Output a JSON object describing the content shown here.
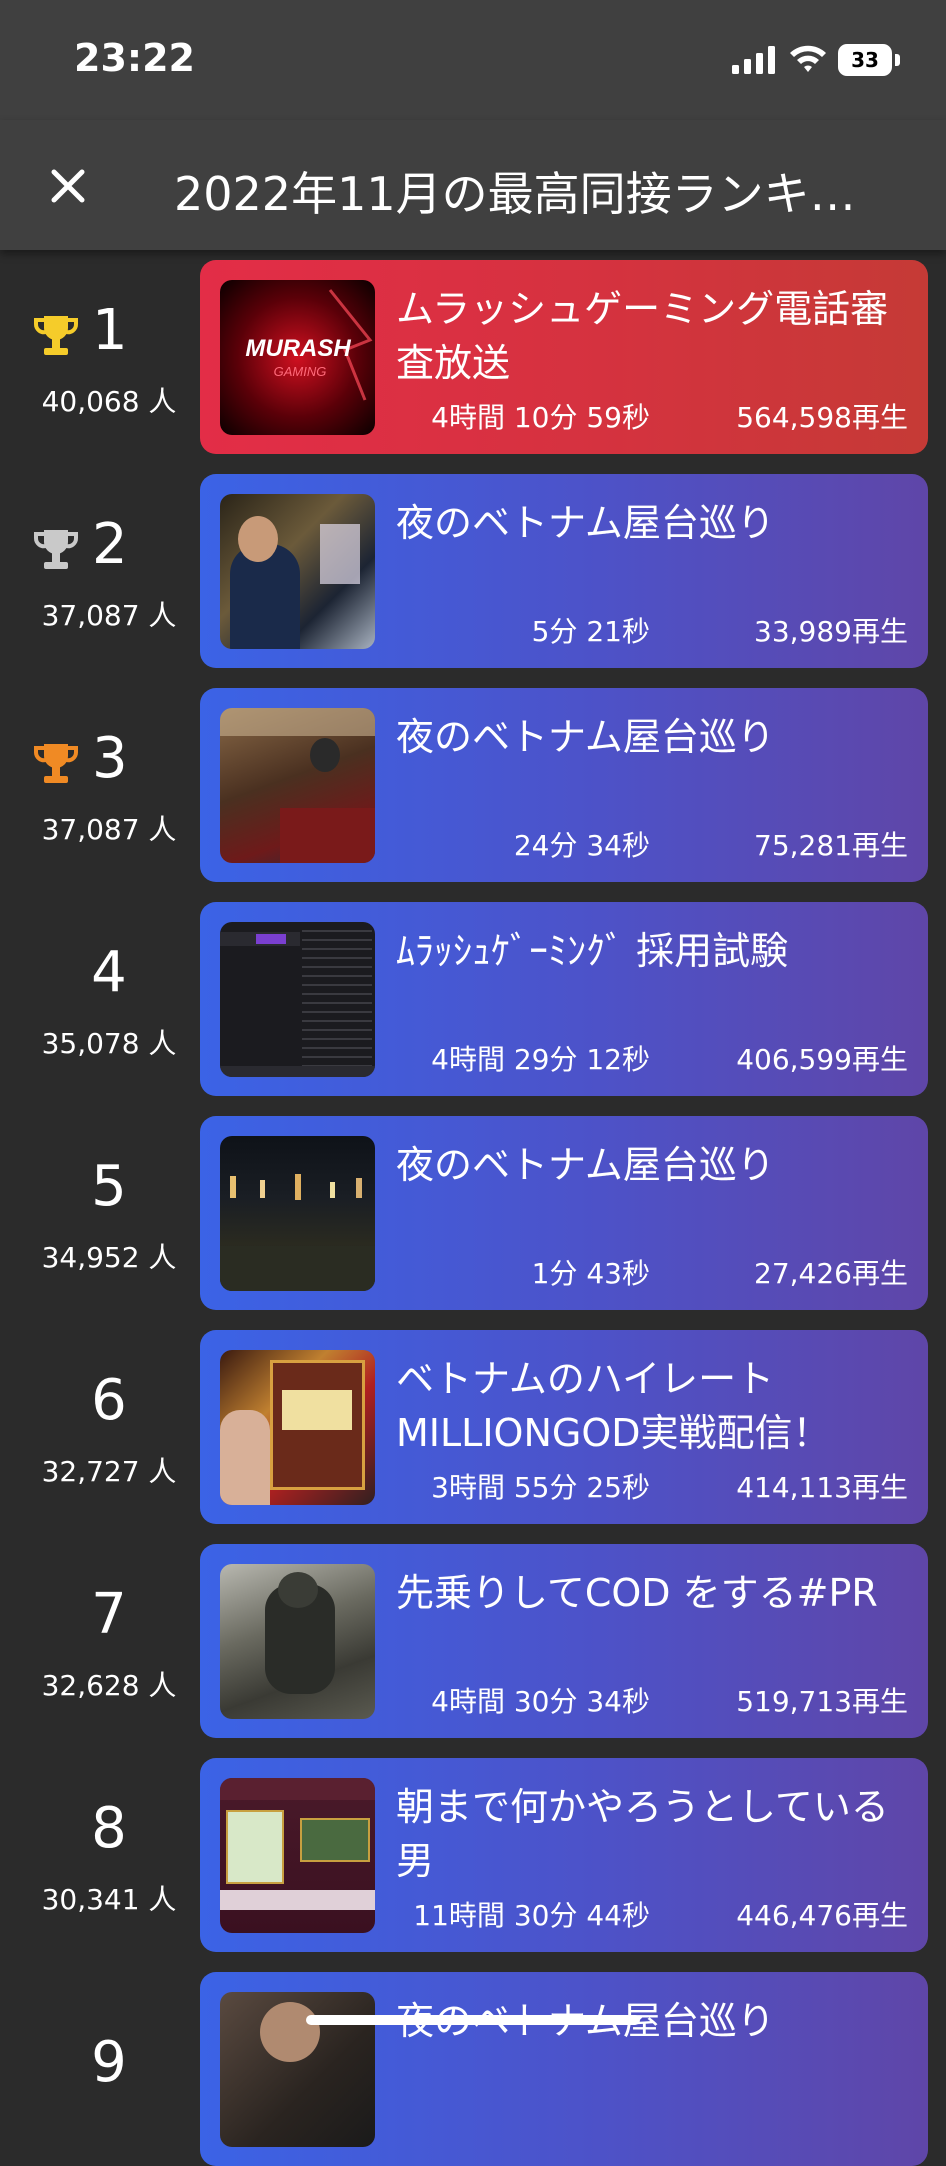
{
  "status_bar": {
    "time": "23:22",
    "battery": "33"
  },
  "header": {
    "title": "2022年11月の最高同接ランキ…"
  },
  "rankings": [
    {
      "rank": "1",
      "viewers": "40,068 人",
      "title": "ムラッシュゲーミング電話審査放送",
      "duration": "4時間 10分 59秒",
      "plays": "564,598再生",
      "trophy": "gold"
    },
    {
      "rank": "2",
      "viewers": "37,087 人",
      "title": "夜のベトナム屋台巡り",
      "duration": "5分 21秒",
      "plays": "33,989再生",
      "trophy": "silver"
    },
    {
      "rank": "3",
      "viewers": "37,087 人",
      "title": "夜のベトナム屋台巡り",
      "duration": "24分 34秒",
      "plays": "75,281再生",
      "trophy": "bronze"
    },
    {
      "rank": "4",
      "viewers": "35,078 人",
      "title": "ﾑﾗｯｼｭｹﾞｰﾐﾝｸﾞ 採用試験",
      "duration": "4時間 29分 12秒",
      "plays": "406,599再生"
    },
    {
      "rank": "5",
      "viewers": "34,952 人",
      "title": "夜のベトナム屋台巡り",
      "duration": "1分 43秒",
      "plays": "27,426再生"
    },
    {
      "rank": "6",
      "viewers": "32,727 人",
      "title": "ベトナムのハイレート MILLIONGOD実戦配信！",
      "duration": "3時間 55分 25秒",
      "plays": "414,113再生"
    },
    {
      "rank": "7",
      "viewers": "32,628 人",
      "title": "先乗りしてCOD をする#PR",
      "duration": "4時間 30分 34秒",
      "plays": "519,713再生"
    },
    {
      "rank": "8",
      "viewers": "30,341 人",
      "title": "朝まで何かやろうとしている男",
      "duration": "11時間 30分 44秒",
      "plays": "446,476再生"
    },
    {
      "rank": "9",
      "title": "夜のベトナム屋台巡り"
    }
  ],
  "thumb1_logo": {
    "line1": "MURASH",
    "line2": "GAMING"
  },
  "colors": {
    "gold": "#f5cc2a",
    "silver": "#c9c9c9",
    "bronze": "#f08a24",
    "card_blue": "#3b63e6",
    "card_purple": "#5f46a8",
    "card_red": "#e32d47"
  }
}
